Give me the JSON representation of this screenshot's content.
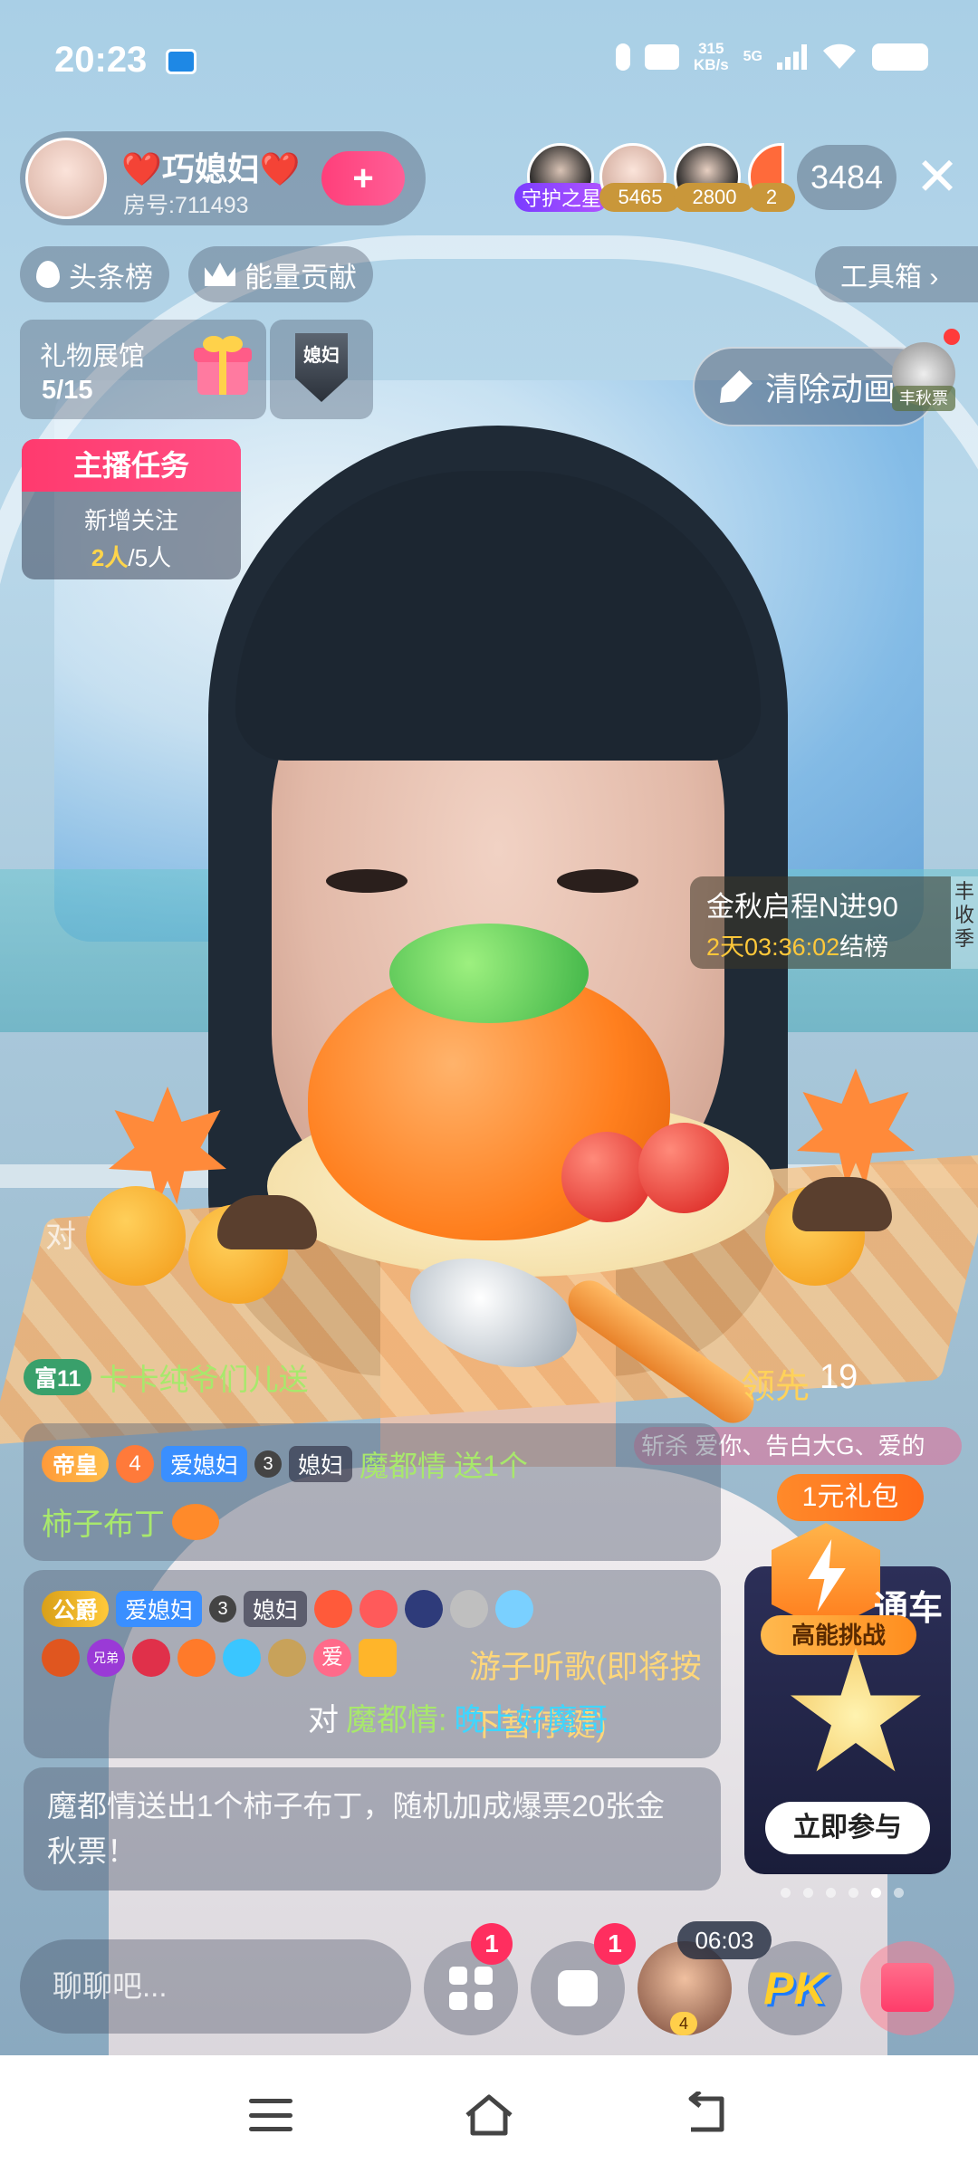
{
  "status": {
    "time": "20:23",
    "net_speed": "315",
    "net_unit": "KB/s",
    "signal": "5G"
  },
  "host": {
    "name": "❤️巧媳妇❤️",
    "room": "房号:711493",
    "follow_symbol": "+"
  },
  "viewers": {
    "guard_label": "守护之星",
    "values": [
      "5465",
      "2800",
      "2"
    ],
    "count": "3484",
    "close_symbol": "✕"
  },
  "ranks": {
    "headline": "头条榜",
    "energy": "能量贡献",
    "toolbox": "工具箱 ›"
  },
  "gift_hall": {
    "title": "礼物展馆",
    "count": "5/15",
    "badge_text": "媳妇"
  },
  "clear_anim": {
    "label": "清除动画",
    "tag": "丰秋票"
  },
  "task": {
    "title": "主播任务",
    "label": "新增关注",
    "done": "2人",
    "total": "/5人"
  },
  "event": {
    "title": "金秋启程N进90",
    "days": "2天",
    "time": "03:36:02",
    "suffix": "结榜",
    "side": "丰收季"
  },
  "pk": {
    "vs": "对",
    "lead_label": "领先",
    "lead_value": "19",
    "marquee": "斩杀 爱你、告白大G、爱的"
  },
  "gift_pack": "1元礼包",
  "chat": {
    "line1": {
      "badge": "富11",
      "text": "卡卡纯爷们儿送"
    },
    "msg1": {
      "rank": "帝皇",
      "lvl": "4",
      "fan": "爱媳妇",
      "fan_lvl": "3",
      "group": "媳妇",
      "user": "魔都情",
      "action": "送1个",
      "item": "柿子布丁"
    },
    "msg2": {
      "rank": "公爵",
      "fan": "爱媳妇",
      "fan_lvl": "3",
      "group": "媳妇",
      "badge_brother": "兄弟",
      "badge_love": "爱",
      "user": "游子听歌(即将按下暂停键)",
      "to": "对",
      "target": "魔都情:",
      "content": "晚上好魔哥"
    },
    "system": "魔都情送出1个柿子布丁，随机加成爆票20张金秋票！"
  },
  "promo": {
    "title": "通车",
    "tag": "高能挑战",
    "button": "立即参与"
  },
  "bottom": {
    "placeholder": "聊聊吧...",
    "notif1": "1",
    "notif2": "1",
    "timer": "06:03",
    "avatar_level": "4",
    "pk_label": "PK"
  },
  "colors": {
    "accent_pink": "#ff3a6e",
    "gold": "#ffd77a",
    "cyan": "#3fd6ff"
  }
}
